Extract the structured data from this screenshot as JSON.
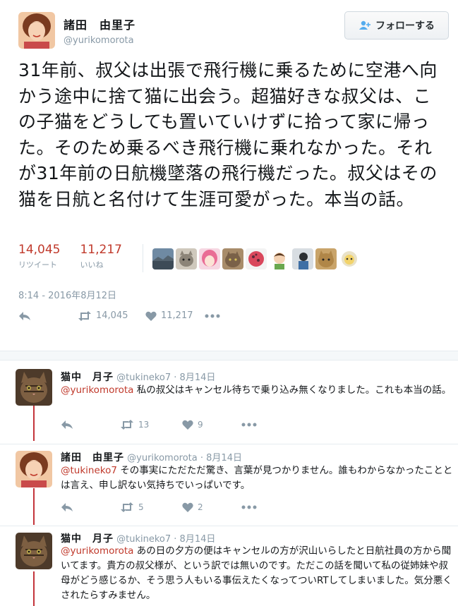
{
  "main_tweet": {
    "display_name": "諸田　由里子",
    "handle": "@yurikomorota",
    "follow_label": "フォローする",
    "text": "31年前、叔父は出張で飛行機に乗るために空港へ向かう途中に捨て猫に出会う。超猫好きな叔父は、この子猫をどうしても置いていけずに拾って家に帰った。そのため乗るべき飛行機に乗れなかった。それが31年前の日航機墜落の飛行機だった。叔父はその猫を日航と名付けて生涯可愛がった。本当の話。",
    "retweets": "14,045",
    "retweets_label": "リツイート",
    "likes": "11,217",
    "likes_label": "いいね",
    "timestamp": "8:14 - 2016年8月12日",
    "action_retweets": "14,045",
    "action_likes": "11,217"
  },
  "replies": [
    {
      "display_name": "猫中　月子",
      "handle": "@tukineko7",
      "time": "· 8月14日",
      "mention": "@yurikomorota",
      "text": " 私の叔父はキャンセル待ちで乗り込み無くなりました。これも本当の話。",
      "retweets": "13",
      "likes": "9"
    },
    {
      "display_name": "諸田　由里子",
      "handle": "@yurikomorota",
      "time": "· 8月14日",
      "mention": "@tukineko7",
      "text": " その事実にただただ驚き、言葉が見つかりません。誰もわからなかったこととは言え、申し訳ない気持ちでいっぱいです。",
      "retweets": "5",
      "likes": "2"
    },
    {
      "display_name": "猫中　月子",
      "handle": "@tukineko7",
      "time": "· 8月14日",
      "mention": "@yurikomorota",
      "text": " あの日の夕方の便はキャンセルの方が沢山いらしたと日航社員の方から聞いてます。貴方の叔父様が、という訳では無いのです。ただこの話を聞いて私の従姉妹や叔母がどう感じるか、そう思う人もいる事伝えたくなってついRTしてしまいました。気分悪くされたらすみません。",
      "retweets": "",
      "likes": ""
    }
  ],
  "colors": {
    "accent": "#c0392b",
    "thread_line": "#c3343b",
    "muted": "#8899a6"
  },
  "icons": [
    "reply-icon",
    "retweet-icon",
    "heart-icon",
    "more-icon",
    "follow-person-icon"
  ]
}
